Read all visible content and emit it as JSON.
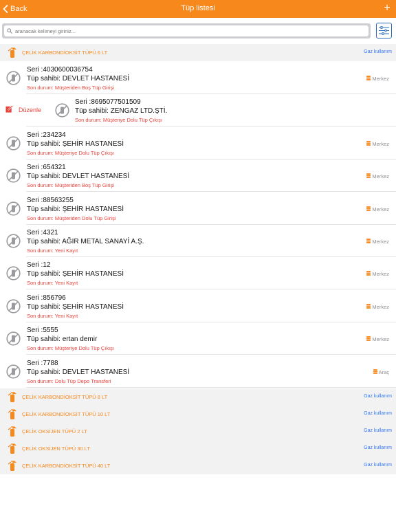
{
  "nav": {
    "back_label": "Back",
    "title": "Tüp listesi",
    "add_label": "+"
  },
  "search": {
    "placeholder": "aranacak kelimeyi giriniz..."
  },
  "colors": {
    "accent": "#f7881c",
    "link": "#3478f6",
    "status_red": "#e8423a"
  },
  "groups": [
    {
      "title": "ÇELİK KARBONDİOKSİT TÜPÜ 6 LT",
      "action": "Gaz kullanım"
    },
    {
      "title": "ÇELİK KARBONDİOKSİT TÜPÜ 8 LT",
      "action": "Gaz kullanım"
    },
    {
      "title": "ÇELİK KARBONDİOKSİT TÜPÜ 10 LT",
      "action": "Gaz kullanım"
    },
    {
      "title": "ÇELİK OKSİJEN TÜPÜ 2 LT",
      "action": "Gaz kullanım"
    },
    {
      "title": "ÇELİK OKSİJEN TÜPÜ 30 LT",
      "action": "Gaz kullanım"
    },
    {
      "title": "ÇELİK KARBONDİOKSİT TÜPÜ 40 LT",
      "action": "Gaz kullanım"
    }
  ],
  "edit_label": "Düzenle",
  "rows": [
    {
      "serial": "Seri :4030600036754",
      "owner": "Tüp sahibi: DEVLET HASTANESİ",
      "status": "Son durum: Müşteriden Boş Tüp Girişi",
      "location": "Merkez"
    },
    {
      "serial": "Seri :8695077501509",
      "owner": "Tüp sahibi: ZENGAZ LTD.ŞTİ.",
      "status": "Son durum: Müşteriye Dolu Tüp Çıkışı",
      "location": ""
    },
    {
      "serial": "Seri :234234",
      "owner": "Tüp sahibi: ŞEHİR HASTANESİ",
      "status": "Son durum: Müşteriye Dolu Tüp Çıkışı",
      "location": "Merkez"
    },
    {
      "serial": "Seri :654321",
      "owner": "Tüp sahibi: DEVLET HASTANESİ",
      "status": "Son durum: Müşteriden Boş Tüp Girişi",
      "location": "Merkez"
    },
    {
      "serial": "Seri :88563255",
      "owner": "Tüp sahibi: ŞEHİR HASTANESİ",
      "status": "Son durum: Müşteriden Dolu Tüp Girişi",
      "location": "Merkez"
    },
    {
      "serial": "Seri :4321",
      "owner": "Tüp sahibi: AĞIR METAL SANAYİ A.Ş.",
      "status": "Son durum: Yeni Kayıt",
      "location": "Merkez"
    },
    {
      "serial": "Seri :12",
      "owner": "Tüp sahibi: ŞEHİR HASTANESİ",
      "status": "Son durum: Yeni Kayıt",
      "location": "Merkez"
    },
    {
      "serial": "Seri :856796",
      "owner": "Tüp sahibi: ŞEHİR HASTANESİ",
      "status": "Son durum: Yeni Kayıt",
      "location": "Merkez"
    },
    {
      "serial": "Seri :5555",
      "owner": "Tüp sahibi: ertan demir",
      "status": "Son durum: Müşteriye Dolu Tüp Çıkışı",
      "location": "Merkez"
    },
    {
      "serial": "Seri :7788",
      "owner": "Tüp sahibi: DEVLET HASTANESİ",
      "status": "Son durum: Dolu Tüp Depo Transferi",
      "location": "Araç"
    }
  ]
}
